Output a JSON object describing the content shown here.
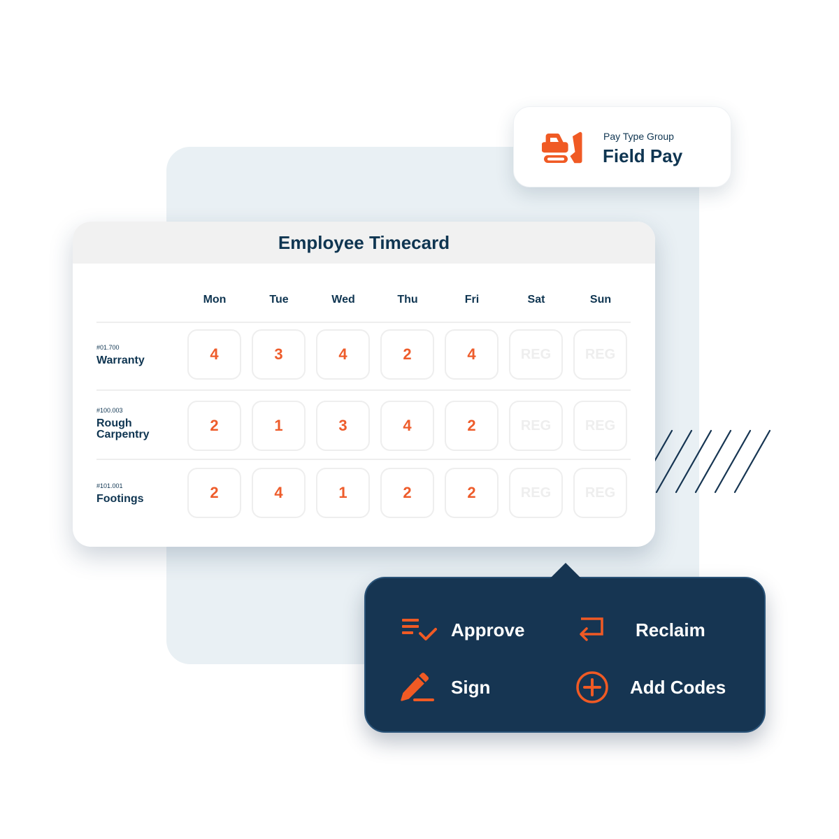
{
  "pay_type": {
    "subtitle": "Pay Type Group",
    "title": "Field Pay",
    "icon": "excavator-icon"
  },
  "timecard": {
    "title": "Employee Timecard",
    "days": [
      "Mon",
      "Tue",
      "Wed",
      "Thu",
      "Fri",
      "Sat",
      "Sun"
    ],
    "rows": [
      {
        "code": "#01.700",
        "name": "Warranty",
        "hours": [
          "4",
          "3",
          "4",
          "2",
          "4",
          "REG",
          "REG"
        ]
      },
      {
        "code": "#100.003",
        "name": "Rough Carpentry",
        "hours": [
          "2",
          "1",
          "3",
          "4",
          "2",
          "REG",
          "REG"
        ]
      },
      {
        "code": "#101.001",
        "name": "Footings",
        "hours": [
          "2",
          "4",
          "1",
          "2",
          "2",
          "REG",
          "REG"
        ]
      }
    ]
  },
  "actions": [
    {
      "label": "Approve",
      "icon": "list-check-icon"
    },
    {
      "label": "Reclaim",
      "icon": "return-arrow-icon"
    },
    {
      "label": "Sign",
      "icon": "pencil-icon"
    },
    {
      "label": "Add Codes",
      "icon": "plus-circle-icon"
    }
  ],
  "colors": {
    "accent": "#f05a24",
    "navy": "#0f3551",
    "popover": "#163552",
    "panel": "#e9f0f4"
  }
}
